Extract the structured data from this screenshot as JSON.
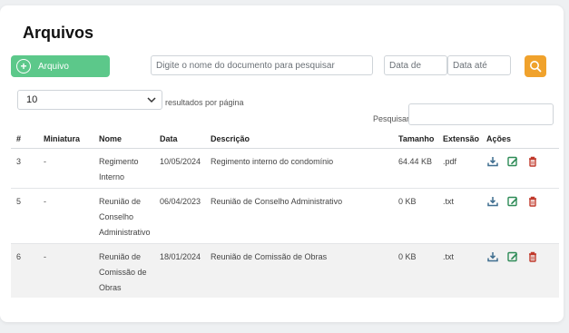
{
  "page": {
    "title": "Arquivos"
  },
  "toolbar": {
    "add_label": "Arquivo",
    "search_placeholder": "Digite o nome do documento para pesquisar",
    "date_from_placeholder": "Data de",
    "date_to_placeholder": "Data até"
  },
  "table_controls": {
    "page_size": "10",
    "per_page_label": "resultados por página",
    "search_label": "Pesquisar"
  },
  "table": {
    "headers": [
      "#",
      "Miniatura",
      "Nome",
      "Data",
      "Descrição",
      "Tamanho",
      "Extensão",
      "Ações"
    ],
    "rows": [
      {
        "id": "3",
        "thumb": "-",
        "name": "Regimento Interno",
        "date": "10/05/2024",
        "description": "Regimento interno do condomínio",
        "size": "64.44 KB",
        "ext": ".pdf"
      },
      {
        "id": "5",
        "thumb": "-",
        "name": "Reunião de Conselho Administrativo",
        "date": "06/04/2023",
        "description": "Reunião de Conselho Administrativo",
        "size": "0 KB",
        "ext": ".txt"
      },
      {
        "id": "6",
        "thumb": "-",
        "name": "Reunião de Comissão de Obras",
        "date": "18/01/2024",
        "description": "Reunião de Comissão de Obras",
        "size": "0 KB",
        "ext": ".txt"
      }
    ]
  },
  "icons": {
    "add": "plus-circle-icon",
    "search": "search-icon",
    "download": "download-icon",
    "edit": "edit-icon",
    "delete": "trash-icon",
    "dropdown": "chevron-down-icon"
  },
  "colors": {
    "add_button": "#5cc88a",
    "search_button": "#f0a22c",
    "download": "#3f6e8f",
    "edit": "#2e8b57",
    "delete": "#c0392b"
  }
}
